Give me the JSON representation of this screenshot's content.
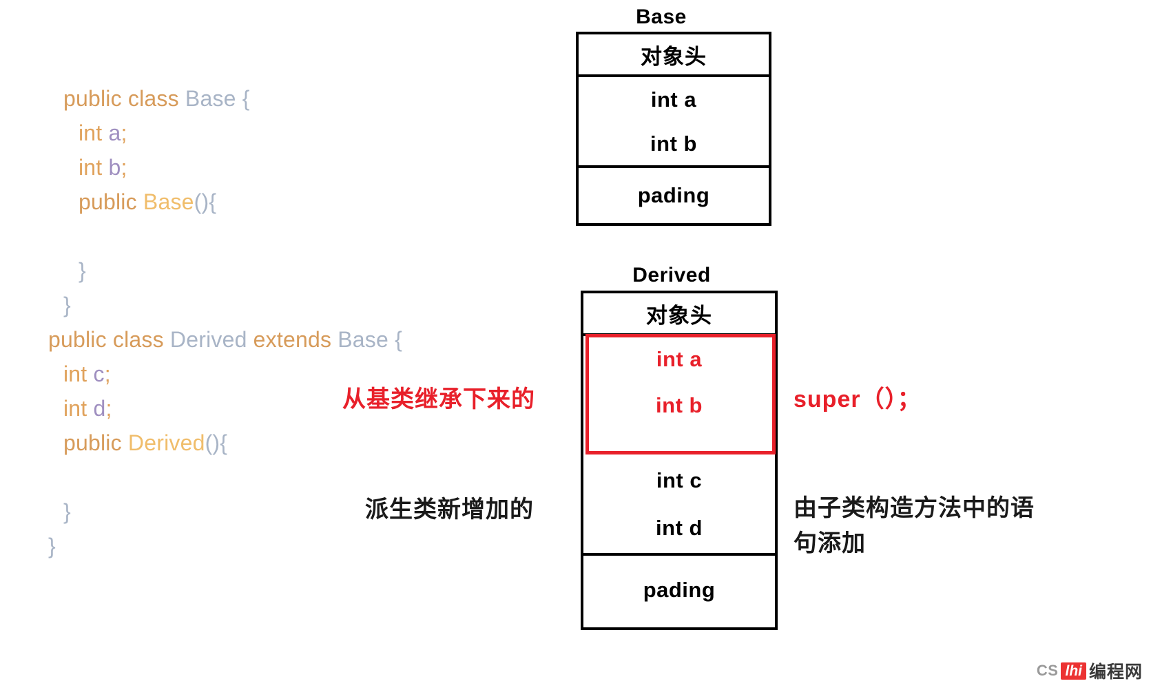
{
  "code": {
    "lines": [
      {
        "indent": 1,
        "tokens": [
          {
            "text": "public class ",
            "kind": "kw"
          },
          {
            "text": "Base ",
            "kind": "cls"
          },
          {
            "text": "{",
            "kind": "punc"
          }
        ]
      },
      {
        "indent": 2,
        "tokens": [
          {
            "text": "int ",
            "kind": "type"
          },
          {
            "text": "a",
            "kind": "var"
          },
          {
            "text": ";",
            "kind": "type"
          }
        ]
      },
      {
        "indent": 2,
        "tokens": [
          {
            "text": "int ",
            "kind": "type"
          },
          {
            "text": "b",
            "kind": "var"
          },
          {
            "text": ";",
            "kind": "type"
          }
        ]
      },
      {
        "indent": 2,
        "tokens": [
          {
            "text": "public ",
            "kind": "kw"
          },
          {
            "text": "Base",
            "kind": "ctor"
          },
          {
            "text": "(){",
            "kind": "punc"
          }
        ]
      },
      {
        "indent": 2,
        "tokens": [
          {
            "text": " ",
            "kind": "punc"
          }
        ]
      },
      {
        "indent": 2,
        "tokens": [
          {
            "text": "}",
            "kind": "punc"
          }
        ]
      },
      {
        "indent": 1,
        "tokens": [
          {
            "text": "}",
            "kind": "punc"
          }
        ]
      },
      {
        "indent": 0,
        "tokens": [
          {
            "text": "public class ",
            "kind": "kw"
          },
          {
            "text": "Derived ",
            "kind": "cls"
          },
          {
            "text": "extends ",
            "kind": "kw"
          },
          {
            "text": "Base ",
            "kind": "cls"
          },
          {
            "text": "{",
            "kind": "punc"
          }
        ]
      },
      {
        "indent": 1,
        "tokens": [
          {
            "text": "int ",
            "kind": "type"
          },
          {
            "text": "c",
            "kind": "var"
          },
          {
            "text": ";",
            "kind": "type"
          }
        ]
      },
      {
        "indent": 1,
        "tokens": [
          {
            "text": "int ",
            "kind": "type"
          },
          {
            "text": "d",
            "kind": "var"
          },
          {
            "text": ";",
            "kind": "type"
          }
        ]
      },
      {
        "indent": 1,
        "tokens": [
          {
            "text": "public ",
            "kind": "kw"
          },
          {
            "text": "Derived",
            "kind": "ctor"
          },
          {
            "text": "(){",
            "kind": "punc"
          }
        ]
      },
      {
        "indent": 1,
        "tokens": [
          {
            "text": " ",
            "kind": "punc"
          }
        ]
      },
      {
        "indent": 1,
        "tokens": [
          {
            "text": "}",
            "kind": "punc"
          }
        ]
      },
      {
        "indent": 0,
        "tokens": [
          {
            "text": "}",
            "kind": "punc"
          }
        ]
      }
    ]
  },
  "base_diagram": {
    "title": "Base",
    "rows": [
      {
        "label": "对象头",
        "style": "cn"
      },
      {
        "label": "int a",
        "style": "en"
      },
      {
        "label": "int b",
        "style": "en"
      },
      {
        "label": "pading",
        "style": "en"
      }
    ]
  },
  "derived_diagram": {
    "title": "Derived",
    "rows": [
      {
        "label": "对象头",
        "style": "cn",
        "color": "black"
      },
      {
        "label": "int a",
        "style": "en",
        "color": "red"
      },
      {
        "label": "int b",
        "style": "en",
        "color": "red"
      },
      {
        "label": "int c",
        "style": "en",
        "color": "black"
      },
      {
        "label": "int d",
        "style": "en",
        "color": "black"
      },
      {
        "label": "pading",
        "style": "en",
        "color": "black"
      }
    ]
  },
  "annotations": {
    "inherited_left": "从基类继承下来的",
    "added_left": "派生类新增加的",
    "super_right": "super（）；",
    "constructor_right": "由子类构造方法中的语\n句添加"
  },
  "colors": {
    "red": "#e8202a",
    "black": "#000000",
    "code_keyword": "#d79b5a",
    "code_class": "#a8b4c6",
    "code_variable": "#9f8fc0",
    "code_constructor": "#f0bd6b"
  },
  "watermark": {
    "prefix": "CS",
    "badge": "lhi",
    "suffix": "编程网"
  }
}
